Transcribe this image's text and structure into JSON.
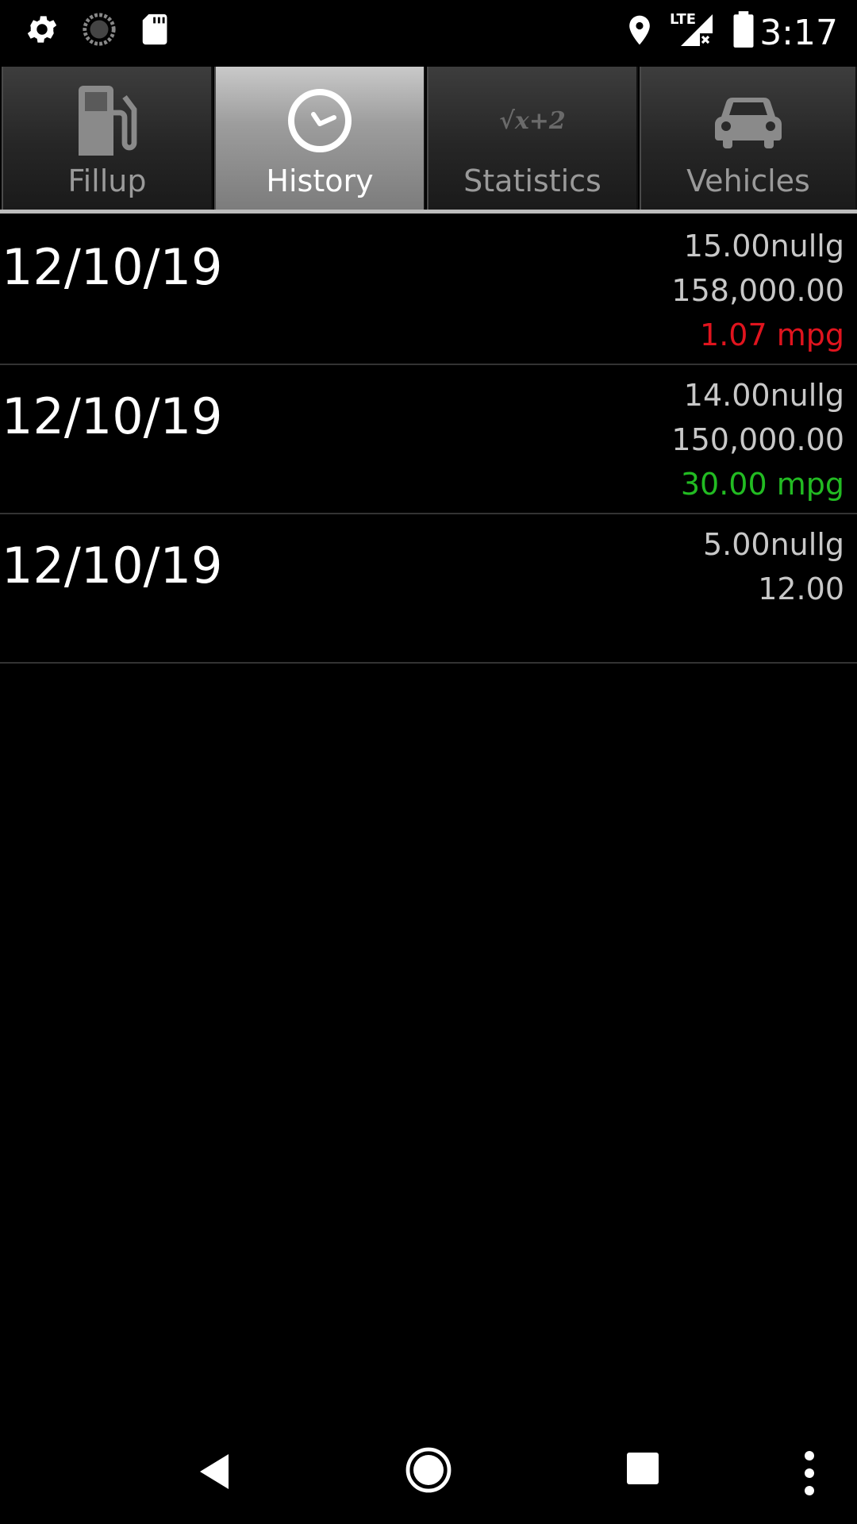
{
  "status_bar": {
    "time": "3:17",
    "network": "LTE",
    "icons": [
      "gear-icon",
      "sync-icon",
      "sd-card-icon",
      "location-icon",
      "signal-icon",
      "battery-icon"
    ]
  },
  "tabs": [
    {
      "label": "Fillup",
      "icon": "fuel-pump-icon",
      "active": false
    },
    {
      "label": "History",
      "icon": "clock-icon",
      "active": true
    },
    {
      "label": "Statistics",
      "icon": "formula-icon",
      "glyph": "√x+2",
      "active": false
    },
    {
      "label": "Vehicles",
      "icon": "car-icon",
      "active": false
    }
  ],
  "history": [
    {
      "date": "12/10/19",
      "gallons": "15.00nullg",
      "odometer": "158,000.00",
      "mpg": "1.07 mpg",
      "mpg_color": "#e0141e"
    },
    {
      "date": "12/10/19",
      "gallons": "14.00nullg",
      "odometer": "150,000.00",
      "mpg": "30.00 mpg",
      "mpg_color": "#22bb22"
    },
    {
      "date": "12/10/19",
      "gallons": "5.00nullg",
      "odometer": "12.00",
      "mpg": ""
    }
  ],
  "nav_bar": {
    "icons": [
      "back-icon",
      "home-icon",
      "recents-icon",
      "overflow-menu-icon"
    ]
  }
}
